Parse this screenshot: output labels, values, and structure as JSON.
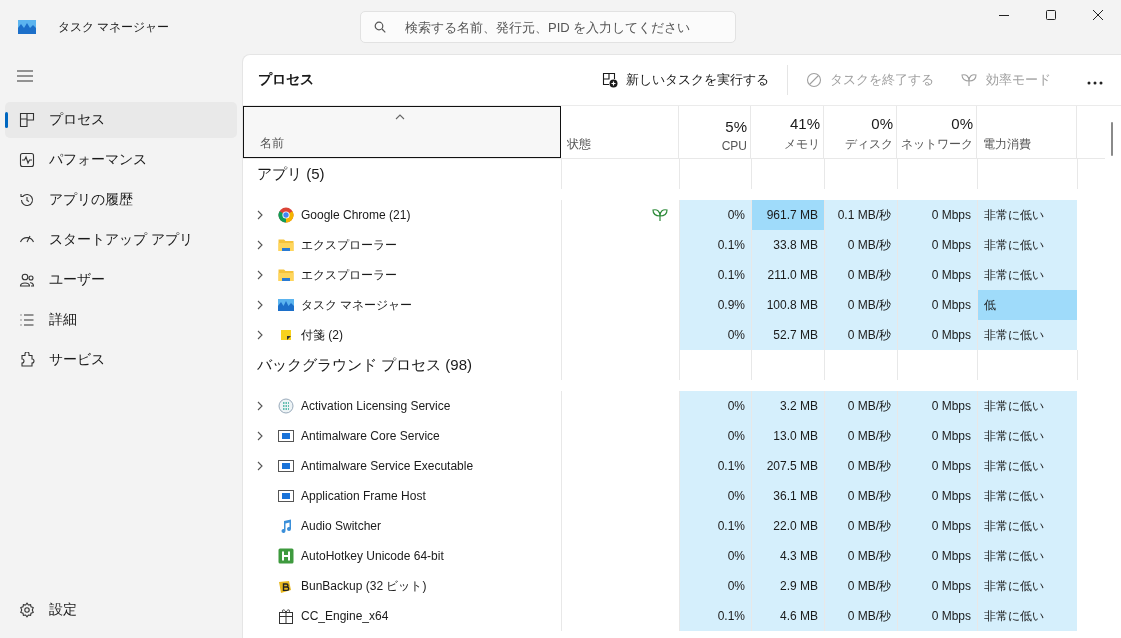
{
  "window": {
    "title": "タスク マネージャー"
  },
  "search": {
    "placeholder": "検索する名前、発行元、PID を入力してください"
  },
  "sidebar": {
    "items": [
      {
        "label": "プロセス",
        "kind": "processes",
        "selected": true
      },
      {
        "label": "パフォーマンス",
        "kind": "performance",
        "selected": false
      },
      {
        "label": "アプリの履歴",
        "kind": "history",
        "selected": false
      },
      {
        "label": "スタートアップ アプリ",
        "kind": "startup",
        "selected": false
      },
      {
        "label": "ユーザー",
        "kind": "users",
        "selected": false
      },
      {
        "label": "詳細",
        "kind": "details",
        "selected": false
      },
      {
        "label": "サービス",
        "kind": "services",
        "selected": false
      }
    ],
    "footer": {
      "label": "設定"
    }
  },
  "page_title": "プロセス",
  "toolbar": [
    {
      "label": "新しいタスクを実行する",
      "kind": "run",
      "disabled": false
    },
    {
      "label": "タスクを終了する",
      "kind": "end",
      "disabled": true
    },
    {
      "label": "効率モード",
      "kind": "eco",
      "disabled": true
    }
  ],
  "table": {
    "columns": [
      {
        "label": "名前",
        "kind": "name"
      },
      {
        "label": "状態",
        "kind": "text"
      },
      {
        "label": "CPU",
        "total": "5%",
        "kind": "num"
      },
      {
        "label": "メモリ",
        "total": "41%",
        "kind": "num"
      },
      {
        "label": "ディスク",
        "total": "0%",
        "kind": "num"
      },
      {
        "label": "ネットワーク",
        "total": "0%",
        "kind": "num"
      },
      {
        "label": "電力消費",
        "kind": "text"
      }
    ],
    "groups": [
      {
        "title": "アプリ (5)",
        "rows": [
          {
            "name": "Google Chrome (21)",
            "expandable": true,
            "efficiency_mode": true,
            "cells": [
              {
                "text": "0%",
                "high": false
              },
              {
                "text": "961.7 MB",
                "high": true
              },
              {
                "text": "0.1 MB/秒",
                "high": false
              },
              {
                "text": "0 Mbps",
                "high": false
              },
              {
                "text": "非常に低い",
                "high": false
              }
            ]
          },
          {
            "name": "エクスプローラー",
            "expandable": true,
            "efficiency_mode": false,
            "cells": [
              {
                "text": "0.1%",
                "high": false
              },
              {
                "text": "33.8 MB",
                "high": false
              },
              {
                "text": "0 MB/秒",
                "high": false
              },
              {
                "text": "0 Mbps",
                "high": false
              },
              {
                "text": "非常に低い",
                "high": false
              }
            ]
          },
          {
            "name": "エクスプローラー",
            "expandable": true,
            "efficiency_mode": false,
            "cells": [
              {
                "text": "0.1%",
                "high": false
              },
              {
                "text": "211.0 MB",
                "high": false
              },
              {
                "text": "0 MB/秒",
                "high": false
              },
              {
                "text": "0 Mbps",
                "high": false
              },
              {
                "text": "非常に低い",
                "high": false
              }
            ]
          },
          {
            "name": "タスク マネージャー",
            "expandable": true,
            "efficiency_mode": false,
            "cells": [
              {
                "text": "0.9%",
                "high": false
              },
              {
                "text": "100.8 MB",
                "high": false
              },
              {
                "text": "0 MB/秒",
                "high": false
              },
              {
                "text": "0 Mbps",
                "high": false
              },
              {
                "text": "低",
                "high": true
              }
            ]
          },
          {
            "name": "付箋 (2)",
            "expandable": true,
            "efficiency_mode": false,
            "cells": [
              {
                "text": "0%",
                "high": false
              },
              {
                "text": "52.7 MB",
                "high": false
              },
              {
                "text": "0 MB/秒",
                "high": false
              },
              {
                "text": "0 Mbps",
                "high": false
              },
              {
                "text": "非常に低い",
                "high": false
              }
            ]
          }
        ]
      },
      {
        "title": "バックグラウンド プロセス (98)",
        "rows": [
          {
            "name": "Activation Licensing Service",
            "expandable": true,
            "efficiency_mode": false,
            "cells": [
              {
                "text": "0%",
                "high": false
              },
              {
                "text": "3.2 MB",
                "high": false
              },
              {
                "text": "0 MB/秒",
                "high": false
              },
              {
                "text": "0 Mbps",
                "high": false
              },
              {
                "text": "非常に低い",
                "high": false
              }
            ]
          },
          {
            "name": "Antimalware Core Service",
            "expandable": true,
            "efficiency_mode": false,
            "cells": [
              {
                "text": "0%",
                "high": false
              },
              {
                "text": "13.0 MB",
                "high": false
              },
              {
                "text": "0 MB/秒",
                "high": false
              },
              {
                "text": "0 Mbps",
                "high": false
              },
              {
                "text": "非常に低い",
                "high": false
              }
            ]
          },
          {
            "name": "Antimalware Service Executable",
            "expandable": true,
            "efficiency_mode": false,
            "cells": [
              {
                "text": "0.1%",
                "high": false
              },
              {
                "text": "207.5 MB",
                "high": false
              },
              {
                "text": "0 MB/秒",
                "high": false
              },
              {
                "text": "0 Mbps",
                "high": false
              },
              {
                "text": "非常に低い",
                "high": false
              }
            ]
          },
          {
            "name": "Application Frame Host",
            "expandable": false,
            "efficiency_mode": false,
            "cells": [
              {
                "text": "0%",
                "high": false
              },
              {
                "text": "36.1 MB",
                "high": false
              },
              {
                "text": "0 MB/秒",
                "high": false
              },
              {
                "text": "0 Mbps",
                "high": false
              },
              {
                "text": "非常に低い",
                "high": false
              }
            ]
          },
          {
            "name": "Audio Switcher",
            "expandable": false,
            "efficiency_mode": false,
            "cells": [
              {
                "text": "0.1%",
                "high": false
              },
              {
                "text": "22.0 MB",
                "high": false
              },
              {
                "text": "0 MB/秒",
                "high": false
              },
              {
                "text": "0 Mbps",
                "high": false
              },
              {
                "text": "非常に低い",
                "high": false
              }
            ]
          },
          {
            "name": "AutoHotkey Unicode 64-bit",
            "expandable": false,
            "efficiency_mode": false,
            "cells": [
              {
                "text": "0%",
                "high": false
              },
              {
                "text": "4.3 MB",
                "high": false
              },
              {
                "text": "0 MB/秒",
                "high": false
              },
              {
                "text": "0 Mbps",
                "high": false
              },
              {
                "text": "非常に低い",
                "high": false
              }
            ]
          },
          {
            "name": "BunBackup (32 ビット)",
            "expandable": false,
            "efficiency_mode": false,
            "cells": [
              {
                "text": "0%",
                "high": false
              },
              {
                "text": "2.9 MB",
                "high": false
              },
              {
                "text": "0 MB/秒",
                "high": false
              },
              {
                "text": "0 Mbps",
                "high": false
              },
              {
                "text": "非常に低い",
                "high": false
              }
            ]
          },
          {
            "name": "CC_Engine_x64",
            "expandable": false,
            "efficiency_mode": false,
            "cells": [
              {
                "text": "0.1%",
                "high": false
              },
              {
                "text": "4.6 MB",
                "high": false
              },
              {
                "text": "0 MB/秒",
                "high": false
              },
              {
                "text": "0 Mbps",
                "high": false
              },
              {
                "text": "非常に低い",
                "high": false
              }
            ]
          }
        ]
      }
    ]
  }
}
